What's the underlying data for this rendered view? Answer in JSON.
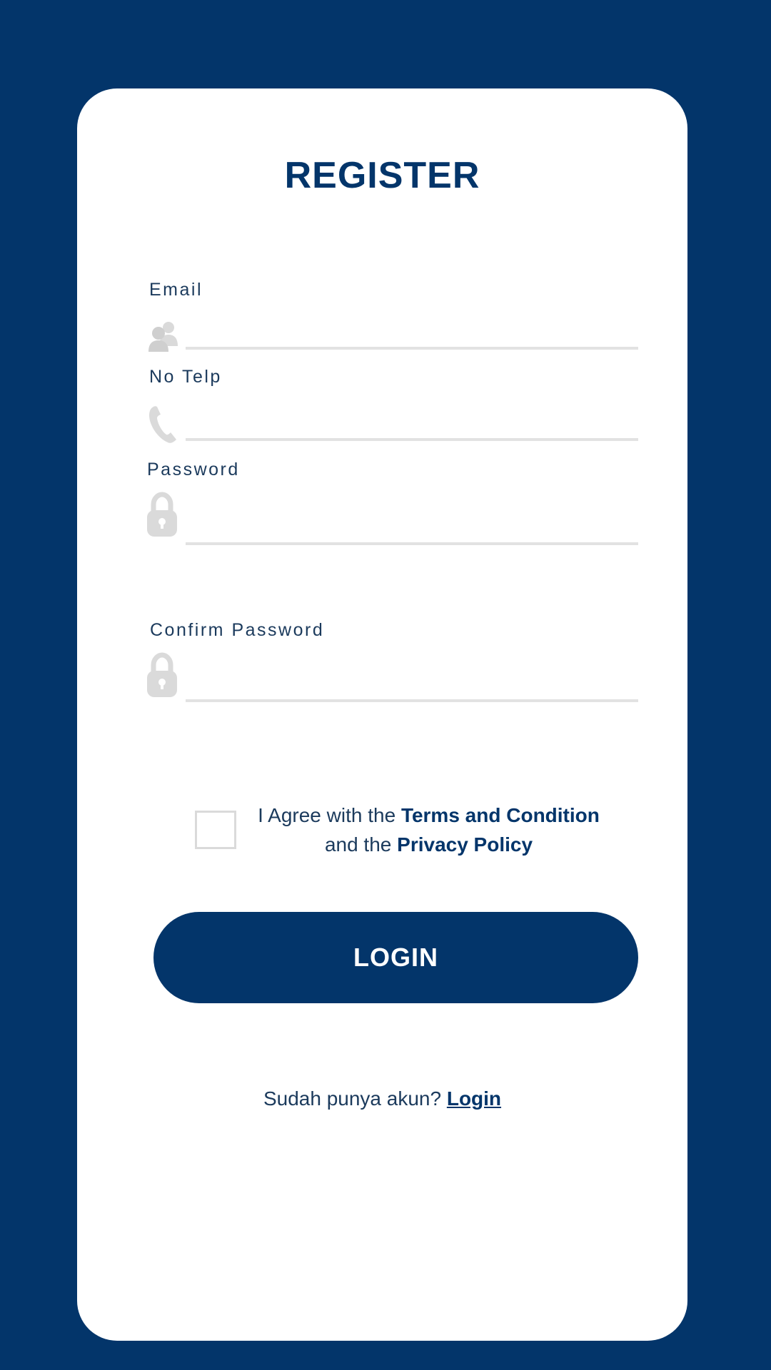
{
  "title": "REGISTER",
  "fields": {
    "email": {
      "label": "Email",
      "value": "",
      "icon": "users-icon"
    },
    "phone": {
      "label": "No Telp",
      "value": "",
      "icon": "phone-icon"
    },
    "password": {
      "label": "Password",
      "value": "",
      "icon": "lock-icon"
    },
    "confirm_password": {
      "label": "Confirm Password",
      "value": "",
      "icon": "lock-icon"
    }
  },
  "agreement": {
    "prefix": "I Agree with the",
    "terms_link": "Terms and Condition",
    "middle": "and the",
    "privacy_link": "Privacy Policy",
    "checked": false
  },
  "submit_label": "LOGIN",
  "footer": {
    "prompt": "Sudah punya akun?",
    "link_label": "Login"
  },
  "colors": {
    "primary": "#03356a",
    "card": "#ffffff",
    "icon": "#dadada",
    "underline": "#e2e2e2",
    "text": "#1b3a5c"
  }
}
